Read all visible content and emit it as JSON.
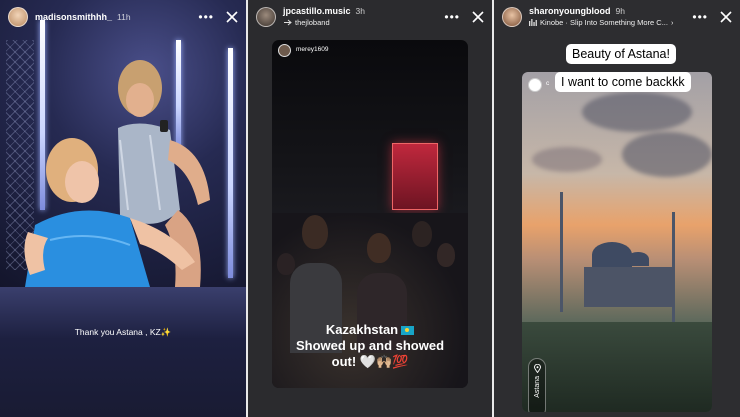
{
  "stories": [
    {
      "username": "madisonsmithhh_",
      "time": "11h",
      "caption": "Thank you Astana , KZ✨"
    },
    {
      "username": "jpcastillo.music",
      "time": "3h",
      "subtitle": "thejloband",
      "inner_username": "merey1609",
      "caption_line1": "Kazakhstan",
      "caption_line2": "Showed up and showed",
      "caption_line3": "out! 🤍🙌🏼💯"
    },
    {
      "username": "sharonyoungblood",
      "time": "9h",
      "music": "Kinobe · Slip Into Something More C...",
      "inner_username": "c",
      "bubble_line1": "Beauty of Astana!",
      "bubble_line2": "I want to come backkk",
      "location": "Astana"
    }
  ],
  "icons": {
    "more": "more-icon",
    "close": "close-icon",
    "music": "music-icon",
    "link": "link-icon",
    "location": "location-pin-icon",
    "flag": "kazakhstan-flag-icon"
  }
}
